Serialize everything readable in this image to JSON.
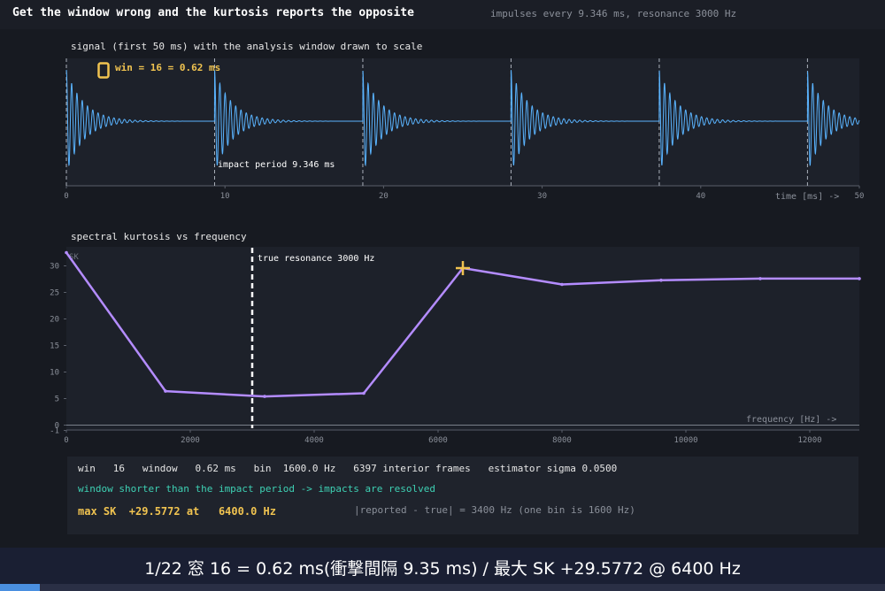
{
  "header": {
    "title": "Get the window wrong and the kurtosis reports the opposite",
    "subtitle": "impulses every 9.346 ms, resonance 3000 Hz"
  },
  "colors": {
    "signal": "#5ab4ff",
    "kurtosis": "#b48cff",
    "window_marker": "#f0c350",
    "accent_text": "#3ed1b4",
    "background": "#171a21"
  },
  "signal_panel": {
    "caption": "signal (first 50 ms) with the analysis window drawn to scale",
    "window_label": "win = 16 = 0.62 ms",
    "period_label": "impact period 9.346 ms",
    "x_axis_label": "time [ms] ->",
    "x_ticks": [
      "0",
      "10",
      "20",
      "30",
      "40",
      "50"
    ]
  },
  "kurtosis_panel": {
    "caption": "spectral kurtosis vs frequency",
    "y_label": "SK",
    "resonance_label": "true resonance 3000 Hz",
    "x_axis_label": "frequency [Hz] ->",
    "x_ticks": [
      "0",
      "2000",
      "4000",
      "6000",
      "8000",
      "10000",
      "12000"
    ],
    "y_ticks": [
      "30",
      "25",
      "20",
      "15",
      "10",
      "5",
      "0",
      "-1"
    ]
  },
  "chart_data": [
    {
      "type": "line",
      "title": "signal (first 50 ms) with the analysis window drawn to scale",
      "xlabel": "time [ms] ->",
      "xlim": [
        0,
        50
      ],
      "impact_times_ms": [
        0,
        9.346,
        18.692,
        28.038,
        37.384,
        46.73
      ],
      "impact_period_ms": 9.346,
      "window_ms": 0.62,
      "resonance_hz": 3000
    },
    {
      "type": "line",
      "title": "spectral kurtosis vs frequency",
      "xlabel": "frequency [Hz] ->",
      "ylabel": "SK",
      "xlim": [
        0,
        12800
      ],
      "ylim": [
        -1,
        33
      ],
      "x": [
        0,
        1600,
        3200,
        4800,
        6400,
        8000,
        9600,
        11200,
        12800
      ],
      "values": [
        32.5,
        6.4,
        5.4,
        6.0,
        29.58,
        26.5,
        27.3,
        27.6,
        27.6
      ],
      "true_resonance_hz": 3000,
      "max_point": {
        "x": 6400,
        "y": 29.5772
      }
    }
  ],
  "stats": {
    "line1": "win   16   window   0.62 ms   bin  1600.0 Hz   6397 interior frames   estimator sigma 0.0500",
    "line2": "window shorter than the impact period -> impacts are resolved",
    "line3": "max SK  +29.5772 at   6400.0 Hz",
    "note": "|reported - true| = 3400 Hz (one bin is 1600 Hz)"
  },
  "footer": {
    "text": "1/22  窓 16 = 0.62 ms(衝撃間隔 9.35 ms)  /  最大 SK +29.5772 @ 6400 Hz",
    "progress": 0.045
  }
}
